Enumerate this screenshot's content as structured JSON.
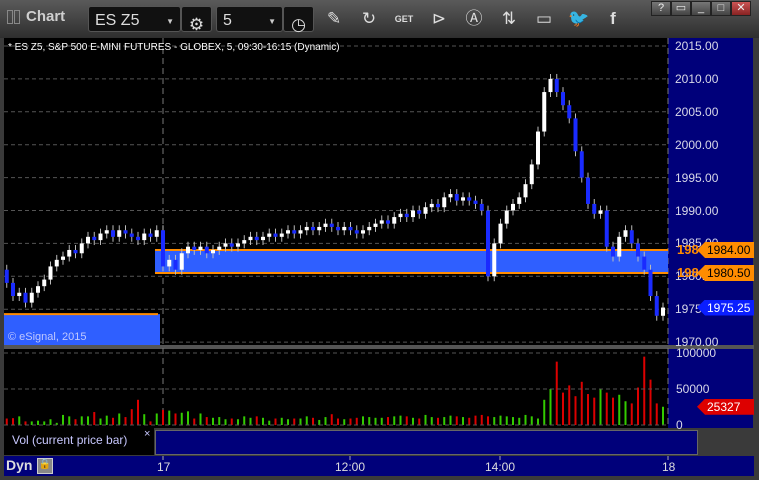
{
  "window": {
    "title": "Chart",
    "buttons": [
      "?",
      "▭",
      "_",
      "□",
      "✕"
    ]
  },
  "toolbar": {
    "symbol": "ES Z5",
    "interval": "5",
    "icons": [
      "gear-icon",
      "clock-icon",
      "pencil-icon",
      "refresh-icon",
      "get-icon",
      "play-icon",
      "alert-icon",
      "arrows-icon",
      "comment-icon",
      "twitter-icon",
      "facebook-icon"
    ],
    "get_label": "GET"
  },
  "chart": {
    "title": "* ES Z5, S&P 500 E-MINI FUTURES - GLOBEX, 5, 09:30-16:15 (Dynamic)",
    "copyright": "© eSignal, 2015"
  },
  "chart_data": {
    "type": "candlestick",
    "price_ticks": [
      "2015.00",
      "2010.00",
      "2005.00",
      "2000.00",
      "1995.00",
      "1990.00",
      "1985.00",
      "1980.00",
      "1975.00",
      "1970.00"
    ],
    "ylim": [
      1970,
      2015
    ],
    "prev_day_first_open": 1981,
    "prev_day_closes": [
      1979,
      1977,
      1977.5,
      1976,
      1977.5,
      1978.5,
      1979.5,
      1981.5,
      1982.5,
      1983,
      1984,
      1983.5,
      1985,
      1986,
      1985.5,
      1986.5,
      1987,
      1986,
      1987,
      1986.5,
      1986,
      1985.5,
      1986.5,
      1986,
      1987
    ],
    "day_closes": [
      1981.5,
      1982.5,
      1981,
      1983.5,
      1984.5,
      1984,
      1984.5,
      1983.5,
      1984,
      1984.5,
      1985,
      1984.5,
      1985,
      1985.5,
      1986,
      1985.5,
      1986,
      1986.5,
      1986,
      1986.5,
      1987,
      1986.5,
      1987,
      1987.5,
      1987,
      1987.5,
      1988,
      1987.5,
      1987,
      1987.5,
      1987,
      1986.5,
      1987,
      1987.5,
      1988,
      1988.5,
      1988,
      1989,
      1989.5,
      1989,
      1990,
      1989.5,
      1990.5,
      1991,
      1990.5,
      1992,
      1992.5,
      1991.5,
      1992,
      1991.5,
      1991,
      1990,
      1980,
      1985,
      1988,
      1990,
      1991,
      1992,
      1994,
      1997,
      2002,
      2008,
      2010,
      2008,
      2006,
      2004,
      1999,
      1995,
      1991,
      1989.5,
      1990,
      1984.5,
      1983,
      1986,
      1987,
      1985,
      1983,
      1981,
      1977,
      1974,
      1975.25
    ],
    "zone": {
      "top": 1984,
      "bottom": 1980.5,
      "top_label": "1984.00",
      "bottom_label": "1980.50",
      "partial_label": "198"
    },
    "prev_zone": {
      "top": 1974.25
    },
    "last_price": "1975.25",
    "volume": {
      "ticks": [
        "100000",
        "50000",
        "0"
      ],
      "ylim": [
        0,
        100000
      ],
      "last": "25327",
      "values": [
        9000,
        9500,
        12000,
        5000,
        5000,
        6000,
        5000,
        8000,
        3000,
        14000,
        12000,
        8000,
        12000,
        12000,
        18000,
        9000,
        13000,
        10000,
        16000,
        11000,
        22000,
        35000,
        15000,
        5000,
        16000,
        21000,
        20000,
        16000,
        17000,
        19000,
        9000,
        16000,
        11000,
        10000,
        11000,
        8000,
        9000,
        8000,
        12000,
        10000,
        12000,
        10000,
        6000,
        9000,
        10000,
        8000,
        9000,
        9000,
        12000,
        10000,
        7000,
        11000,
        15000,
        9000,
        8000,
        9000,
        10000,
        12000,
        11000,
        10000,
        10000,
        11000,
        12000,
        13000,
        12000,
        10000,
        9000,
        14000,
        11000,
        10000,
        11000,
        13000,
        12000,
        11000,
        10000,
        13000,
        14000,
        12000,
        11000,
        13000,
        12000,
        11000,
        10000,
        14000,
        12000,
        9000,
        35000,
        50000,
        88000,
        45000,
        55000,
        40000,
        60000,
        43000,
        38000,
        50000,
        45000,
        38000,
        42000,
        33000,
        30000,
        52000,
        95000,
        63000,
        30000,
        25327
      ]
    },
    "time_ticks": [
      "17",
      "12:00",
      "14:00",
      "18"
    ]
  },
  "indicator": {
    "label": "Vol (current price bar)",
    "close": "×"
  },
  "footer": {
    "mode": "Dyn"
  },
  "colors": {
    "up": "#ffffff",
    "down": "#1a2bff",
    "zone": "#2f5fff",
    "zone_line": "#ff8c00",
    "vol_up": "#33cc00",
    "vol_down": "#dd0000",
    "axis_bg": "#00007a"
  }
}
